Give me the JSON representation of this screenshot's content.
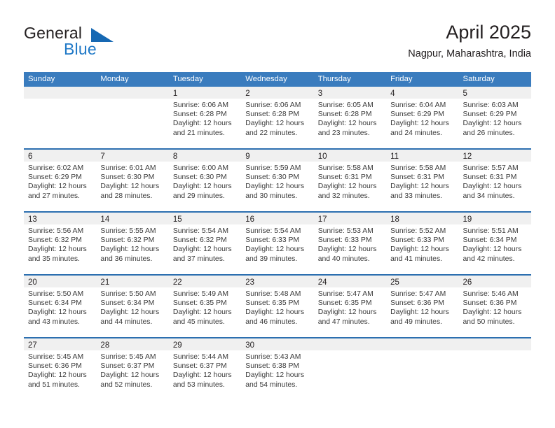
{
  "brand": {
    "name_part1": "General",
    "name_part2": "Blue"
  },
  "header": {
    "title": "April 2025",
    "subtitle": "Nagpur, Maharashtra, India"
  },
  "colors": {
    "header_bar": "#3a7cbe",
    "row_divider": "#2c6fb0",
    "day_strip": "#f0f0f0",
    "brand_blue": "#2079c7",
    "text": "#231f20"
  },
  "weekdays": [
    "Sunday",
    "Monday",
    "Tuesday",
    "Wednesday",
    "Thursday",
    "Friday",
    "Saturday"
  ],
  "weeks": [
    [
      {
        "day": "",
        "lines": []
      },
      {
        "day": "",
        "lines": []
      },
      {
        "day": "1",
        "lines": [
          "Sunrise: 6:06 AM",
          "Sunset: 6:28 PM",
          "Daylight: 12 hours",
          "and 21 minutes."
        ]
      },
      {
        "day": "2",
        "lines": [
          "Sunrise: 6:06 AM",
          "Sunset: 6:28 PM",
          "Daylight: 12 hours",
          "and 22 minutes."
        ]
      },
      {
        "day": "3",
        "lines": [
          "Sunrise: 6:05 AM",
          "Sunset: 6:28 PM",
          "Daylight: 12 hours",
          "and 23 minutes."
        ]
      },
      {
        "day": "4",
        "lines": [
          "Sunrise: 6:04 AM",
          "Sunset: 6:29 PM",
          "Daylight: 12 hours",
          "and 24 minutes."
        ]
      },
      {
        "day": "5",
        "lines": [
          "Sunrise: 6:03 AM",
          "Sunset: 6:29 PM",
          "Daylight: 12 hours",
          "and 26 minutes."
        ]
      }
    ],
    [
      {
        "day": "6",
        "lines": [
          "Sunrise: 6:02 AM",
          "Sunset: 6:29 PM",
          "Daylight: 12 hours",
          "and 27 minutes."
        ]
      },
      {
        "day": "7",
        "lines": [
          "Sunrise: 6:01 AM",
          "Sunset: 6:30 PM",
          "Daylight: 12 hours",
          "and 28 minutes."
        ]
      },
      {
        "day": "8",
        "lines": [
          "Sunrise: 6:00 AM",
          "Sunset: 6:30 PM",
          "Daylight: 12 hours",
          "and 29 minutes."
        ]
      },
      {
        "day": "9",
        "lines": [
          "Sunrise: 5:59 AM",
          "Sunset: 6:30 PM",
          "Daylight: 12 hours",
          "and 30 minutes."
        ]
      },
      {
        "day": "10",
        "lines": [
          "Sunrise: 5:58 AM",
          "Sunset: 6:31 PM",
          "Daylight: 12 hours",
          "and 32 minutes."
        ]
      },
      {
        "day": "11",
        "lines": [
          "Sunrise: 5:58 AM",
          "Sunset: 6:31 PM",
          "Daylight: 12 hours",
          "and 33 minutes."
        ]
      },
      {
        "day": "12",
        "lines": [
          "Sunrise: 5:57 AM",
          "Sunset: 6:31 PM",
          "Daylight: 12 hours",
          "and 34 minutes."
        ]
      }
    ],
    [
      {
        "day": "13",
        "lines": [
          "Sunrise: 5:56 AM",
          "Sunset: 6:32 PM",
          "Daylight: 12 hours",
          "and 35 minutes."
        ]
      },
      {
        "day": "14",
        "lines": [
          "Sunrise: 5:55 AM",
          "Sunset: 6:32 PM",
          "Daylight: 12 hours",
          "and 36 minutes."
        ]
      },
      {
        "day": "15",
        "lines": [
          "Sunrise: 5:54 AM",
          "Sunset: 6:32 PM",
          "Daylight: 12 hours",
          "and 37 minutes."
        ]
      },
      {
        "day": "16",
        "lines": [
          "Sunrise: 5:54 AM",
          "Sunset: 6:33 PM",
          "Daylight: 12 hours",
          "and 39 minutes."
        ]
      },
      {
        "day": "17",
        "lines": [
          "Sunrise: 5:53 AM",
          "Sunset: 6:33 PM",
          "Daylight: 12 hours",
          "and 40 minutes."
        ]
      },
      {
        "day": "18",
        "lines": [
          "Sunrise: 5:52 AM",
          "Sunset: 6:33 PM",
          "Daylight: 12 hours",
          "and 41 minutes."
        ]
      },
      {
        "day": "19",
        "lines": [
          "Sunrise: 5:51 AM",
          "Sunset: 6:34 PM",
          "Daylight: 12 hours",
          "and 42 minutes."
        ]
      }
    ],
    [
      {
        "day": "20",
        "lines": [
          "Sunrise: 5:50 AM",
          "Sunset: 6:34 PM",
          "Daylight: 12 hours",
          "and 43 minutes."
        ]
      },
      {
        "day": "21",
        "lines": [
          "Sunrise: 5:50 AM",
          "Sunset: 6:34 PM",
          "Daylight: 12 hours",
          "and 44 minutes."
        ]
      },
      {
        "day": "22",
        "lines": [
          "Sunrise: 5:49 AM",
          "Sunset: 6:35 PM",
          "Daylight: 12 hours",
          "and 45 minutes."
        ]
      },
      {
        "day": "23",
        "lines": [
          "Sunrise: 5:48 AM",
          "Sunset: 6:35 PM",
          "Daylight: 12 hours",
          "and 46 minutes."
        ]
      },
      {
        "day": "24",
        "lines": [
          "Sunrise: 5:47 AM",
          "Sunset: 6:35 PM",
          "Daylight: 12 hours",
          "and 47 minutes."
        ]
      },
      {
        "day": "25",
        "lines": [
          "Sunrise: 5:47 AM",
          "Sunset: 6:36 PM",
          "Daylight: 12 hours",
          "and 49 minutes."
        ]
      },
      {
        "day": "26",
        "lines": [
          "Sunrise: 5:46 AM",
          "Sunset: 6:36 PM",
          "Daylight: 12 hours",
          "and 50 minutes."
        ]
      }
    ],
    [
      {
        "day": "27",
        "lines": [
          "Sunrise: 5:45 AM",
          "Sunset: 6:36 PM",
          "Daylight: 12 hours",
          "and 51 minutes."
        ]
      },
      {
        "day": "28",
        "lines": [
          "Sunrise: 5:45 AM",
          "Sunset: 6:37 PM",
          "Daylight: 12 hours",
          "and 52 minutes."
        ]
      },
      {
        "day": "29",
        "lines": [
          "Sunrise: 5:44 AM",
          "Sunset: 6:37 PM",
          "Daylight: 12 hours",
          "and 53 minutes."
        ]
      },
      {
        "day": "30",
        "lines": [
          "Sunrise: 5:43 AM",
          "Sunset: 6:38 PM",
          "Daylight: 12 hours",
          "and 54 minutes."
        ]
      },
      {
        "day": "",
        "lines": []
      },
      {
        "day": "",
        "lines": []
      },
      {
        "day": "",
        "lines": []
      }
    ]
  ]
}
